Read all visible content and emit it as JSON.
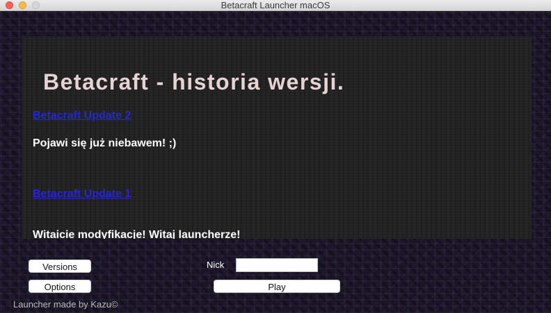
{
  "window": {
    "title": "Betacraft Launcher macOS"
  },
  "news": {
    "heading": "Betacraft - historia wersji.",
    "entries": [
      {
        "link": "Betacraft Update 2",
        "text": "Pojawi się już niebawem! ;)"
      },
      {
        "link": "Betacraft Update 1",
        "text": "Witaicie modyfikacje! Witaj launcherze!"
      }
    ]
  },
  "controls": {
    "versions_label": "Versions",
    "options_label": "Options",
    "nick_label": "Nick",
    "nick_value": "",
    "play_label": "Play"
  },
  "footer": {
    "credit": "Launcher made by Kazu©"
  },
  "colors": {
    "link": "#2323e8",
    "heading": "#e6d3d3",
    "panel_bg": "#232323",
    "window_bg": "#1a1628"
  }
}
